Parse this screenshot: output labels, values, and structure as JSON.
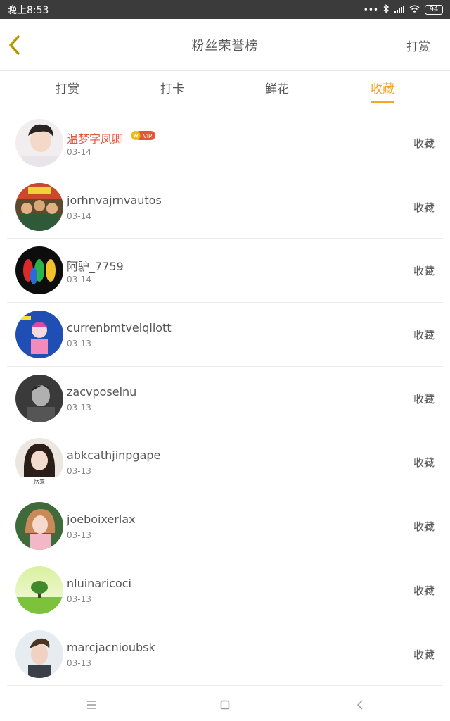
{
  "status_bar": {
    "time": "晚上8:53",
    "battery": "94",
    "icons": [
      "dots-icon",
      "bluetooth-icon",
      "signal-icon",
      "wifi-icon",
      "battery-icon"
    ]
  },
  "nav": {
    "title": "粉丝荣誉榜",
    "action_label": "打赏",
    "back_icon": "chevron-left-icon",
    "accent": "#f5a623"
  },
  "tabs": [
    {
      "label": "打赏",
      "active": false
    },
    {
      "label": "打卡",
      "active": false
    },
    {
      "label": "鲜花",
      "active": false
    },
    {
      "label": "收藏",
      "active": true
    }
  ],
  "list": {
    "items": [
      {
        "name": "温梦字凤卿",
        "date": "03-14",
        "action": "收藏",
        "vip": "VIP"
      },
      {
        "name": "jorhnvajrnvautos",
        "date": "03-14",
        "action": "收藏"
      },
      {
        "name": "阿驴_7759",
        "date": "03-14",
        "action": "收藏"
      },
      {
        "name": "currenbmtvelqliott",
        "date": "03-13",
        "action": "收藏"
      },
      {
        "name": "zacvposelnu",
        "date": "03-13",
        "action": "收藏"
      },
      {
        "name": "abkcathjinpgape",
        "date": "03-13",
        "action": "收藏",
        "avatar_caption": "岳来"
      },
      {
        "name": "joeboixerlax",
        "date": "03-13",
        "action": "收藏"
      },
      {
        "name": "nluinaricoci",
        "date": "03-13",
        "action": "收藏"
      },
      {
        "name": "marcjacnioubsk",
        "date": "03-13",
        "action": "收藏"
      }
    ]
  },
  "bottom_bar": {
    "icons": [
      "menu-icon",
      "home-square-icon",
      "back-triangle-icon"
    ]
  },
  "colors": {
    "accent": "#f5a623",
    "highlight_name": "#e8563a",
    "vip_badge": "#e8563a"
  }
}
